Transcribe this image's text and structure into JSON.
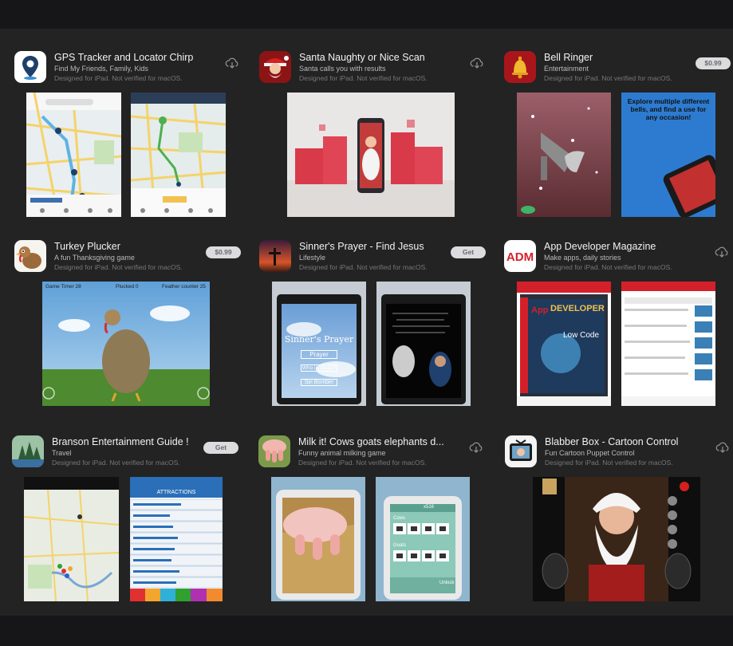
{
  "apps": [
    {
      "title": "GPS Tracker and Locator Chirp",
      "subtitle": "Find My Friends, Family, Kids",
      "note": "Designed for iPad. Not verified for macOS.",
      "action": "",
      "icon": "gps-location-pin-icon"
    },
    {
      "title": "Santa Naughty or Nice Scan",
      "subtitle": "Santa calls you with results",
      "note": "Designed for iPad. Not verified for macOS.",
      "action": "",
      "icon": "santa-icon"
    },
    {
      "title": "Bell Ringer",
      "subtitle": "Entertainment",
      "note": "Designed for iPad. Not verified for macOS.",
      "action": "$0.99",
      "icon": "bell-icon"
    },
    {
      "title": "Turkey Plucker",
      "subtitle": "A fun Thanksgiving game",
      "note": "Designed for iPad. Not verified for macOS.",
      "action": "$0.99",
      "icon": "turkey-icon"
    },
    {
      "title": "Sinner's Prayer - Find Jesus",
      "subtitle": "Lifestyle",
      "note": "Designed for iPad. Not verified for macOS.",
      "action": "Get",
      "icon": "cross-sunset-icon"
    },
    {
      "title": "App Developer Magazine",
      "subtitle": "Make apps, daily stories",
      "note": "Designed for iPad. Not verified for macOS.",
      "action": "",
      "icon": "adm-logo-icon"
    },
    {
      "title": "Branson Entertainment Guide !",
      "subtitle": "Travel",
      "note": "Designed for iPad. Not verified for macOS.",
      "action": "Get",
      "icon": "forest-icon"
    },
    {
      "title": "Milk it! Cows goats elephants d...",
      "subtitle": "Funny animal milking game",
      "note": "Designed for iPad. Not verified for macOS.",
      "action": "",
      "icon": "udder-icon"
    },
    {
      "title": "Blabber Box - Cartoon Control",
      "subtitle": "Fun Cartoon Puppet Control",
      "note": "Designed for iPad. Not verified for macOS.",
      "action": "",
      "icon": "tv-cartoon-icon"
    }
  ],
  "screens": {
    "turkey": {
      "timer": "Game Timer 28",
      "plucked": "Plucked 0",
      "feathers": "Feather counter 25"
    },
    "prayer": {
      "title": "Sinner's Prayer",
      "b1": "Prayer",
      "b2": "Who is Jesus?",
      "b3": "Sin Bomber"
    },
    "bell": {
      "text": "Explore multiple different bells, and find a use for any occasion!"
    },
    "branson": {
      "header": "ATTRACTIONS"
    },
    "milk": {
      "cows": "Cows",
      "goats": "Goats",
      "unlock": "Unlock",
      "price": "x516"
    },
    "adm": {
      "word1": "App",
      "word2": "DEVELOPER",
      "word3": "Low Code"
    }
  },
  "colors": {
    "background": "#232323",
    "pill": "#dcdcde",
    "pill_text": "#6a6a70"
  }
}
